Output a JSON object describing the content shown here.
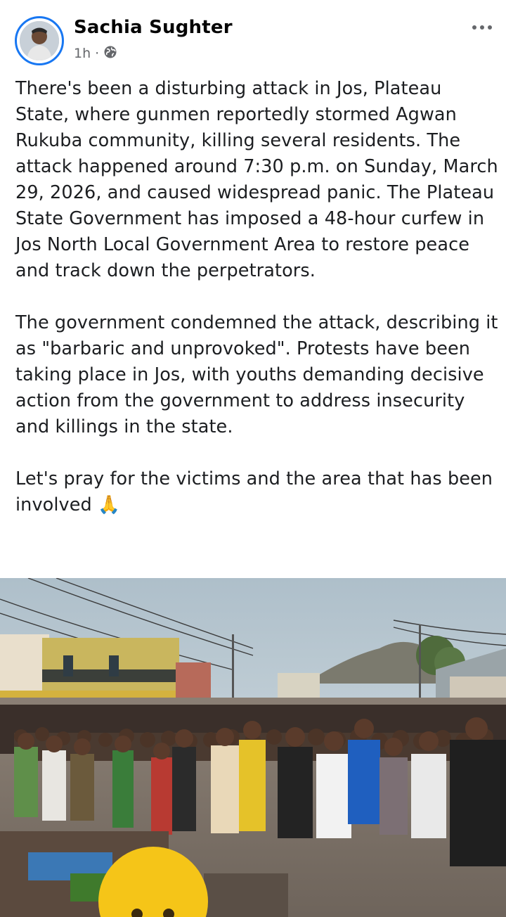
{
  "post": {
    "author": "Sachia Sughter",
    "time": "1h",
    "audience_icon": "globe-icon",
    "more_icon": "more-horizontal-icon",
    "paragraphs": [
      "There's been a disturbing attack in Jos, Plateau State, where gunmen reportedly stormed Agwan Rukuba community, killing several residents. The attack happened around 7:30 p.m. on Sunday, March 29, 2026, and caused widespread panic. The Plateau State Government has imposed a 48-hour curfew in Jos North Local Government Area to restore peace and track down the perpetrators.",
      "The government condemned the attack, describing it as \"barbaric and unprovoked\". Protests have been taking place in Jos, with youths demanding decisive action from the government to address insecurity and killings in the state.",
      "Let's pray for the victims and the area that has been involved 🙏"
    ],
    "photo_icon": "crowd-photo"
  },
  "colors": {
    "accent": "#1877f2",
    "text": "#1c1e21",
    "secondary": "#65676b"
  }
}
